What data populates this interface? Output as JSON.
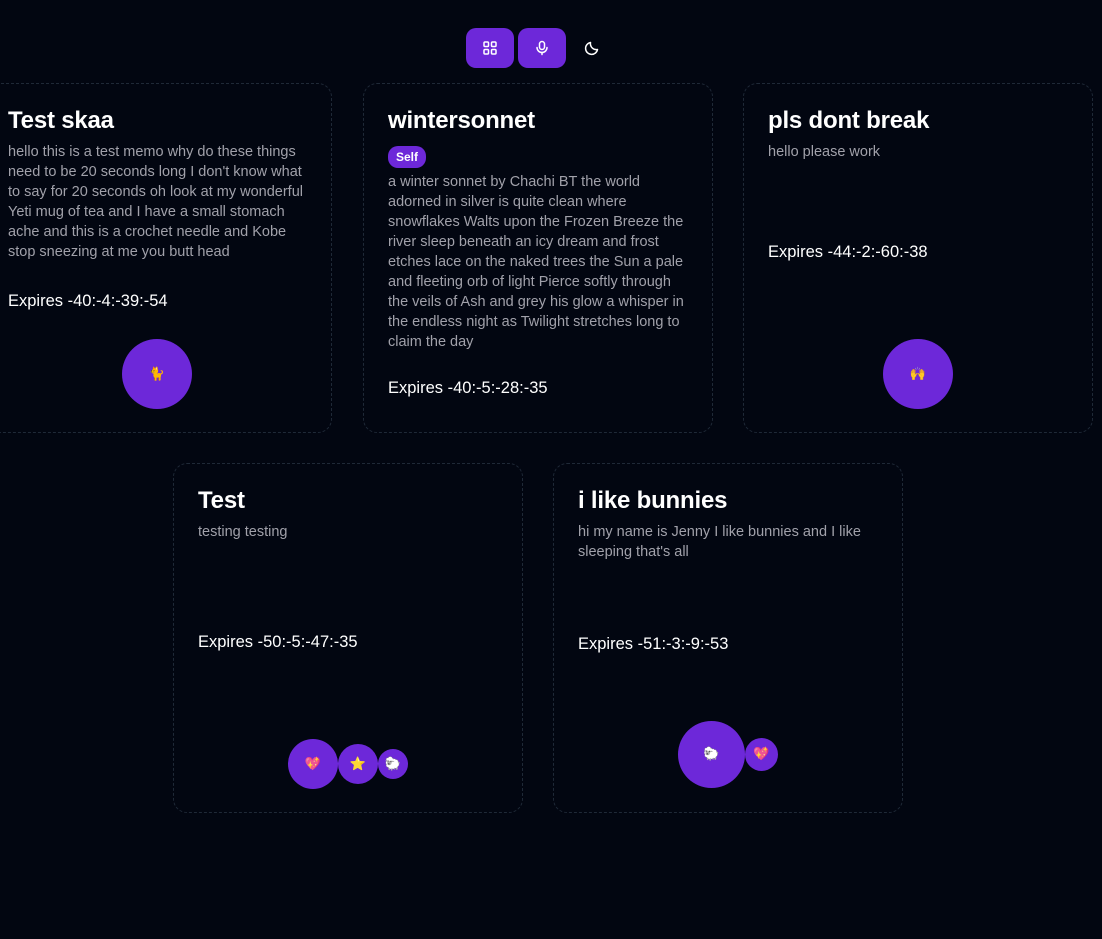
{
  "toolbar": {
    "buttons": [
      {
        "name": "grid-view",
        "icon": "grid-icon"
      },
      {
        "name": "record",
        "icon": "microphone-icon"
      },
      {
        "name": "theme-toggle",
        "icon": "moon-icon"
      }
    ]
  },
  "colors": {
    "background": "#020611",
    "accent": "#6d28d9",
    "muted_text": "#a1a1aa",
    "card_border": "#1f2937"
  },
  "memos": [
    {
      "title": "Test skaa",
      "body": "hello this is a test memo why do these things need to be 20 seconds long I don't know what to say for 20 seconds oh look at my wonderful Yeti mug of tea and I have a small stomach ache and this is a crochet needle and Kobe stop sneezing at me you butt head",
      "expires": "Expires -40:-4:-39:-54",
      "reactions": [
        {
          "emoji": "🐈",
          "name": "cat-emoji"
        }
      ]
    },
    {
      "title": "wintersonnet",
      "badge": "Self",
      "body": "a winter sonnet by Chachi BT the world adorned in silver is quite clean where snowflakes Walts upon the Frozen Breeze the river sleep beneath an icy dream and frost etches lace on the naked trees the Sun a pale and fleeting orb of light Pierce softly through the veils of Ash and grey his glow a whisper in the endless night as Twilight stretches long to claim the day",
      "expires": "Expires -40:-5:-28:-35",
      "reactions": []
    },
    {
      "title": "pls dont break",
      "body": "hello please work",
      "expires": "Expires -44:-2:-60:-38",
      "reactions": [
        {
          "emoji": "🙌",
          "name": "raised-hands-emoji"
        }
      ]
    },
    {
      "title": "Test",
      "body": "testing testing",
      "expires": "Expires -50:-5:-47:-35",
      "reactions": [
        {
          "emoji": "💖",
          "name": "sparkling-heart-emoji"
        },
        {
          "emoji": "⭐",
          "name": "star-emoji"
        },
        {
          "emoji": "🐑",
          "name": "sheep-emoji"
        }
      ]
    },
    {
      "title": "i like bunnies",
      "body": "hi my name is Jenny I like bunnies and I like sleeping that's all",
      "expires": "Expires -51:-3:-9:-53",
      "reactions": [
        {
          "emoji": "🐑",
          "name": "sheep-emoji"
        },
        {
          "emoji": "💖",
          "name": "sparkling-heart-emoji"
        }
      ]
    }
  ]
}
